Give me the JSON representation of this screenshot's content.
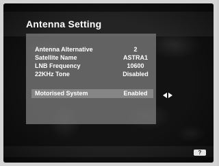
{
  "menu": {
    "title": "Antenna Setting",
    "rows": [
      {
        "label": "Antenna Alternative",
        "value": "2"
      },
      {
        "label": "Satellite Name",
        "value": "ASTRA1"
      },
      {
        "label": "LNB Frequency",
        "value": "10600"
      },
      {
        "label": "22KHz Tone",
        "value": "Disabled"
      }
    ],
    "selected_row": {
      "label": "Motorised System",
      "value": "Enabled"
    }
  },
  "footer": {
    "help_key": "?"
  },
  "icons": {
    "adjust": "left-right-arrows-icon"
  },
  "colors": {
    "screen_bg": "#121212",
    "panel": "#787878",
    "text": "#ffffff"
  }
}
